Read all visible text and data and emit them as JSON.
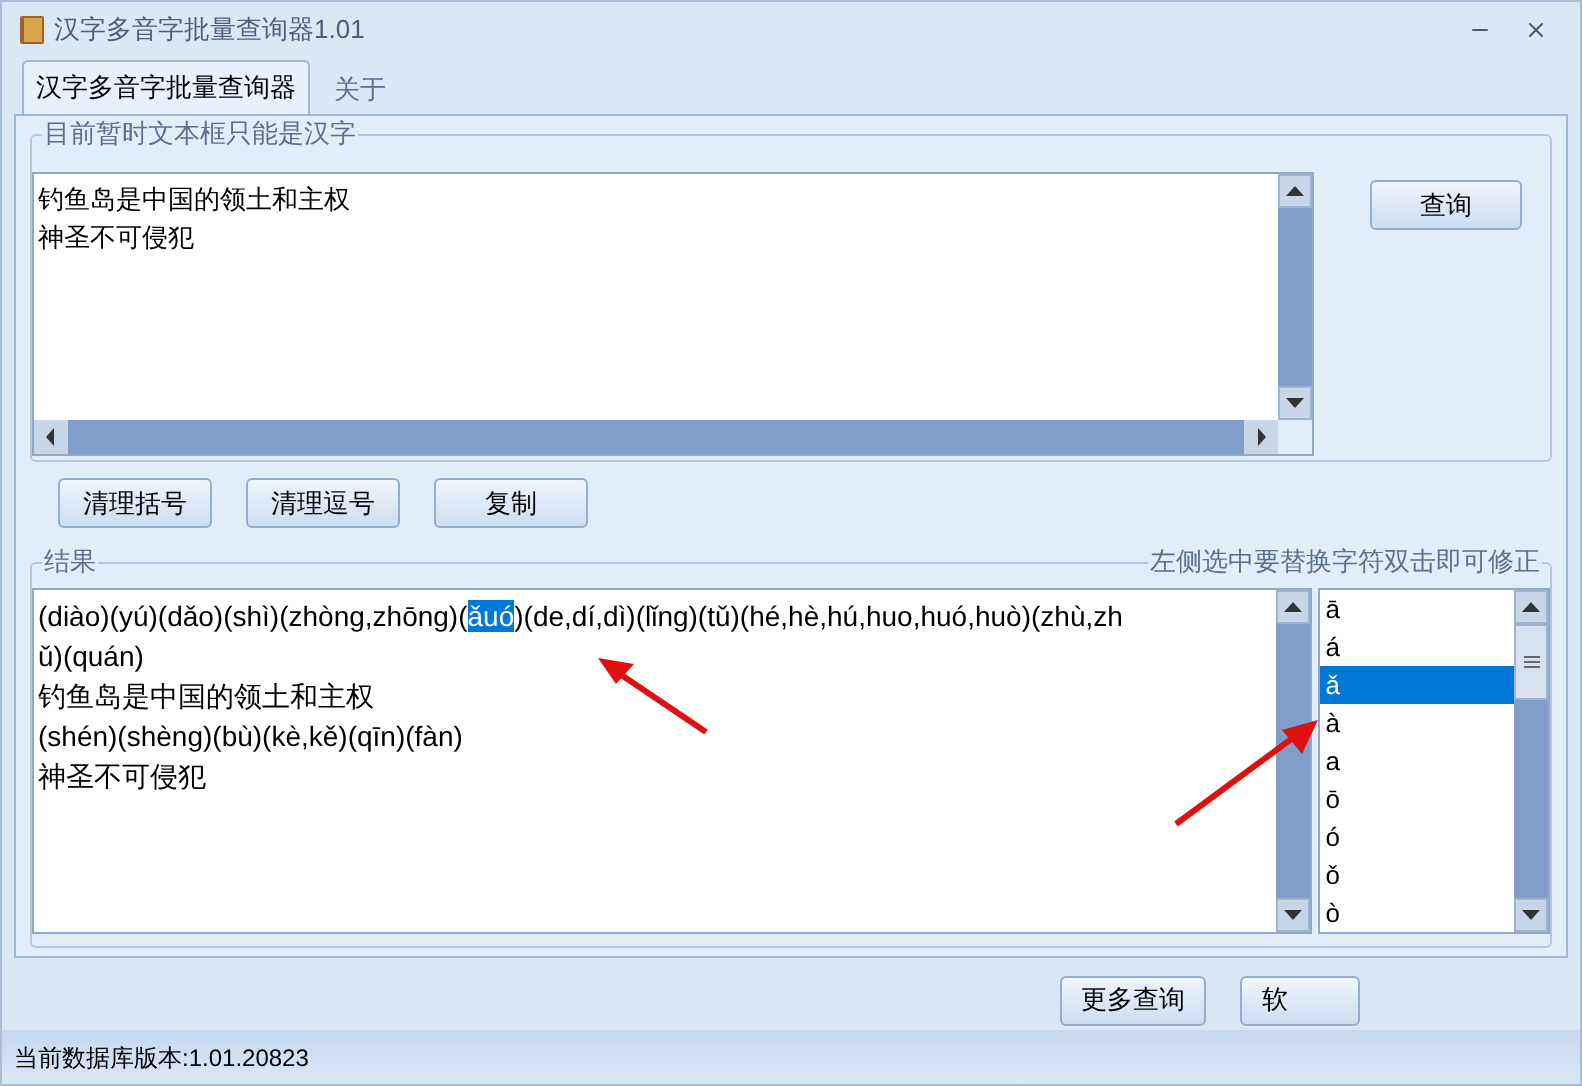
{
  "window": {
    "title": "汉字多音字批量查询器1.01"
  },
  "tabs": [
    {
      "label": "汉字多音字批量查询器",
      "selected": true
    },
    {
      "label": "关于",
      "selected": false
    }
  ],
  "input_group": {
    "legend": "目前暂时文本框只能是汉字",
    "lines": [
      "钓鱼岛是中国的领土和主权",
      "神圣不可侵犯"
    ],
    "query_button": "查询"
  },
  "tool_buttons": [
    "清理括号",
    "清理逗号",
    "复制"
  ],
  "result_group": {
    "legend": "结果",
    "hint": "左侧选中要替换字符双击即可修正",
    "lines": [
      [
        {
          "text": "(diào)(yú)(dǎo)(shì)(zhòng,zhōng)(",
          "selected": false
        },
        {
          "text": "ǎuó",
          "selected": true
        },
        {
          "text": ")(de,dí,dì)(lǐng)(tǔ)(hé,hè,hú,huo,huó,huò)(zhù,zh",
          "selected": false
        }
      ],
      [
        {
          "text": "ǔ)(quán)",
          "selected": false
        }
      ],
      [
        {
          "text": "钓鱼岛是中国的领土和主权",
          "selected": false
        }
      ],
      [
        {
          "text": "(shén)(shèng)(bù)(kè,kě)(qīn)(fàn)",
          "selected": false
        }
      ],
      [
        {
          "text": "神圣不可侵犯",
          "selected": false
        }
      ]
    ],
    "characters": [
      {
        "label": "ā",
        "selected": false
      },
      {
        "label": "á",
        "selected": false
      },
      {
        "label": "ǎ",
        "selected": true
      },
      {
        "label": "à",
        "selected": false
      },
      {
        "label": "a",
        "selected": false
      },
      {
        "label": "ō",
        "selected": false
      },
      {
        "label": "ó",
        "selected": false
      },
      {
        "label": "ǒ",
        "selected": false
      },
      {
        "label": "ò",
        "selected": false
      }
    ]
  },
  "bottom_buttons": [
    "更多查询",
    "软"
  ],
  "status_bar": "当前数据库版本:1.01.20823"
}
